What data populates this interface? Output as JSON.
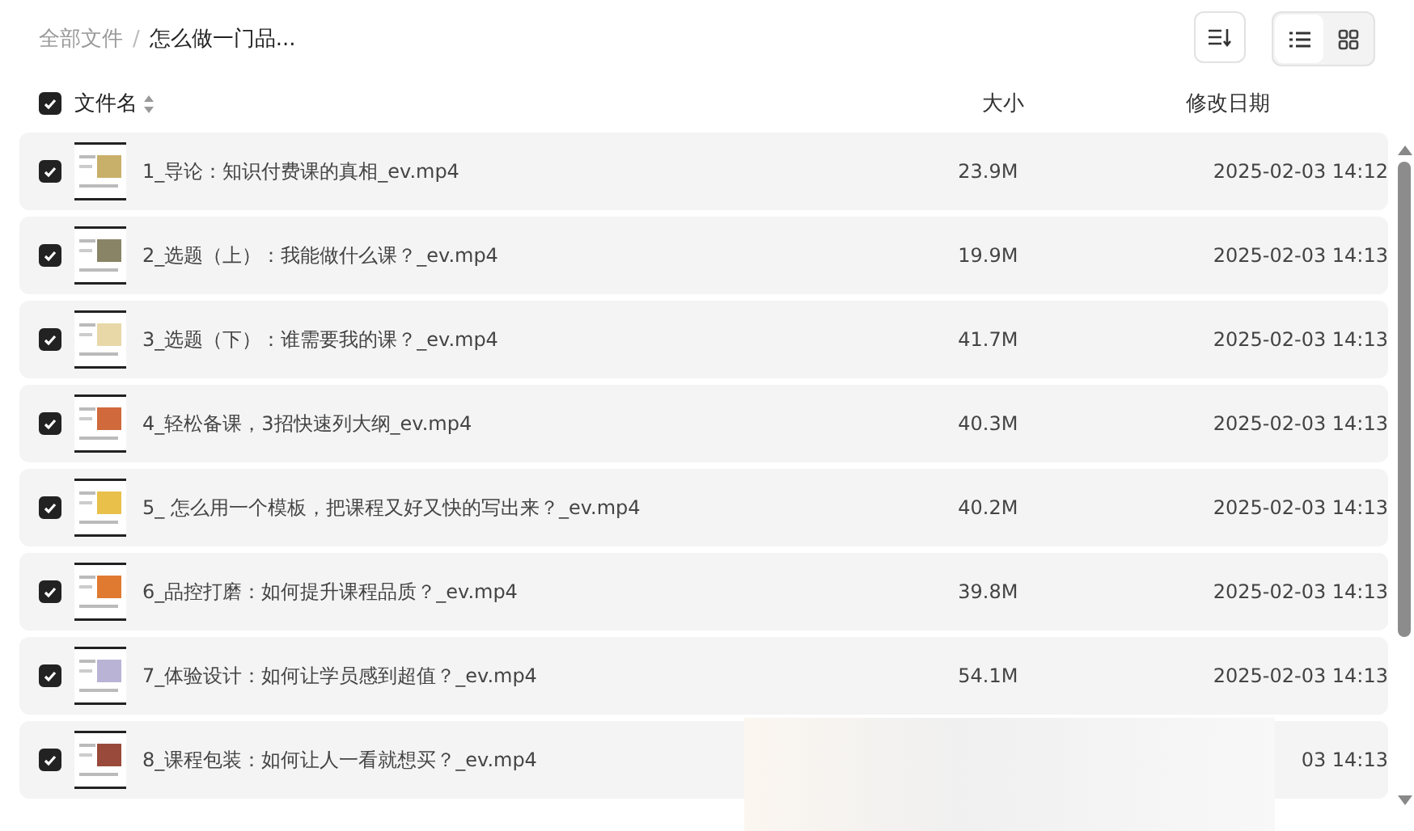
{
  "breadcrumb_separator": "/",
  "breadcrumb": [
    {
      "label": "全部文件",
      "current": false
    },
    {
      "label": "怎么做一门品...",
      "current": true
    }
  ],
  "view_toggle": [
    {
      "kind": "list",
      "selected": true
    },
    {
      "kind": "grid",
      "selected": false
    }
  ],
  "header": {
    "checked": true,
    "name": "文件名",
    "size": "大小",
    "date": "修改日期"
  },
  "rows": [
    {
      "checked": true,
      "name": "1_导论：知识付费课的真相_ev.mp4",
      "size": "23.9M",
      "date": "2025-02-03 14:12"
    },
    {
      "checked": true,
      "name": "2_选题（上）：我能做什么课？_ev.mp4",
      "size": "19.9M",
      "date": "2025-02-03 14:13"
    },
    {
      "checked": true,
      "name": "3_选题（下）：谁需要我的课？_ev.mp4",
      "size": "41.7M",
      "date": "2025-02-03 14:13"
    },
    {
      "checked": true,
      "name": "4_轻松备课，3招快速列大纲_ev.mp4",
      "size": "40.3M",
      "date": "2025-02-03 14:13"
    },
    {
      "checked": true,
      "name": "5_ 怎么用一个模板，把课程又好又快的写出来？_ev.mp4",
      "size": "40.2M",
      "date": "2025-02-03 14:13"
    },
    {
      "checked": true,
      "name": "6_品控打磨：如何提升课程品质？_ev.mp4",
      "size": "39.8M",
      "date": "2025-02-03 14:13"
    },
    {
      "checked": true,
      "name": "7_体验设计：如何让学员感到超值？_ev.mp4",
      "size": "54.1M",
      "date": "2025-02-03 14:13"
    },
    {
      "checked": true,
      "name": "8_课程包装：如何让人一看就想买？_ev.mp4",
      "date": "03 14:13"
    }
  ]
}
